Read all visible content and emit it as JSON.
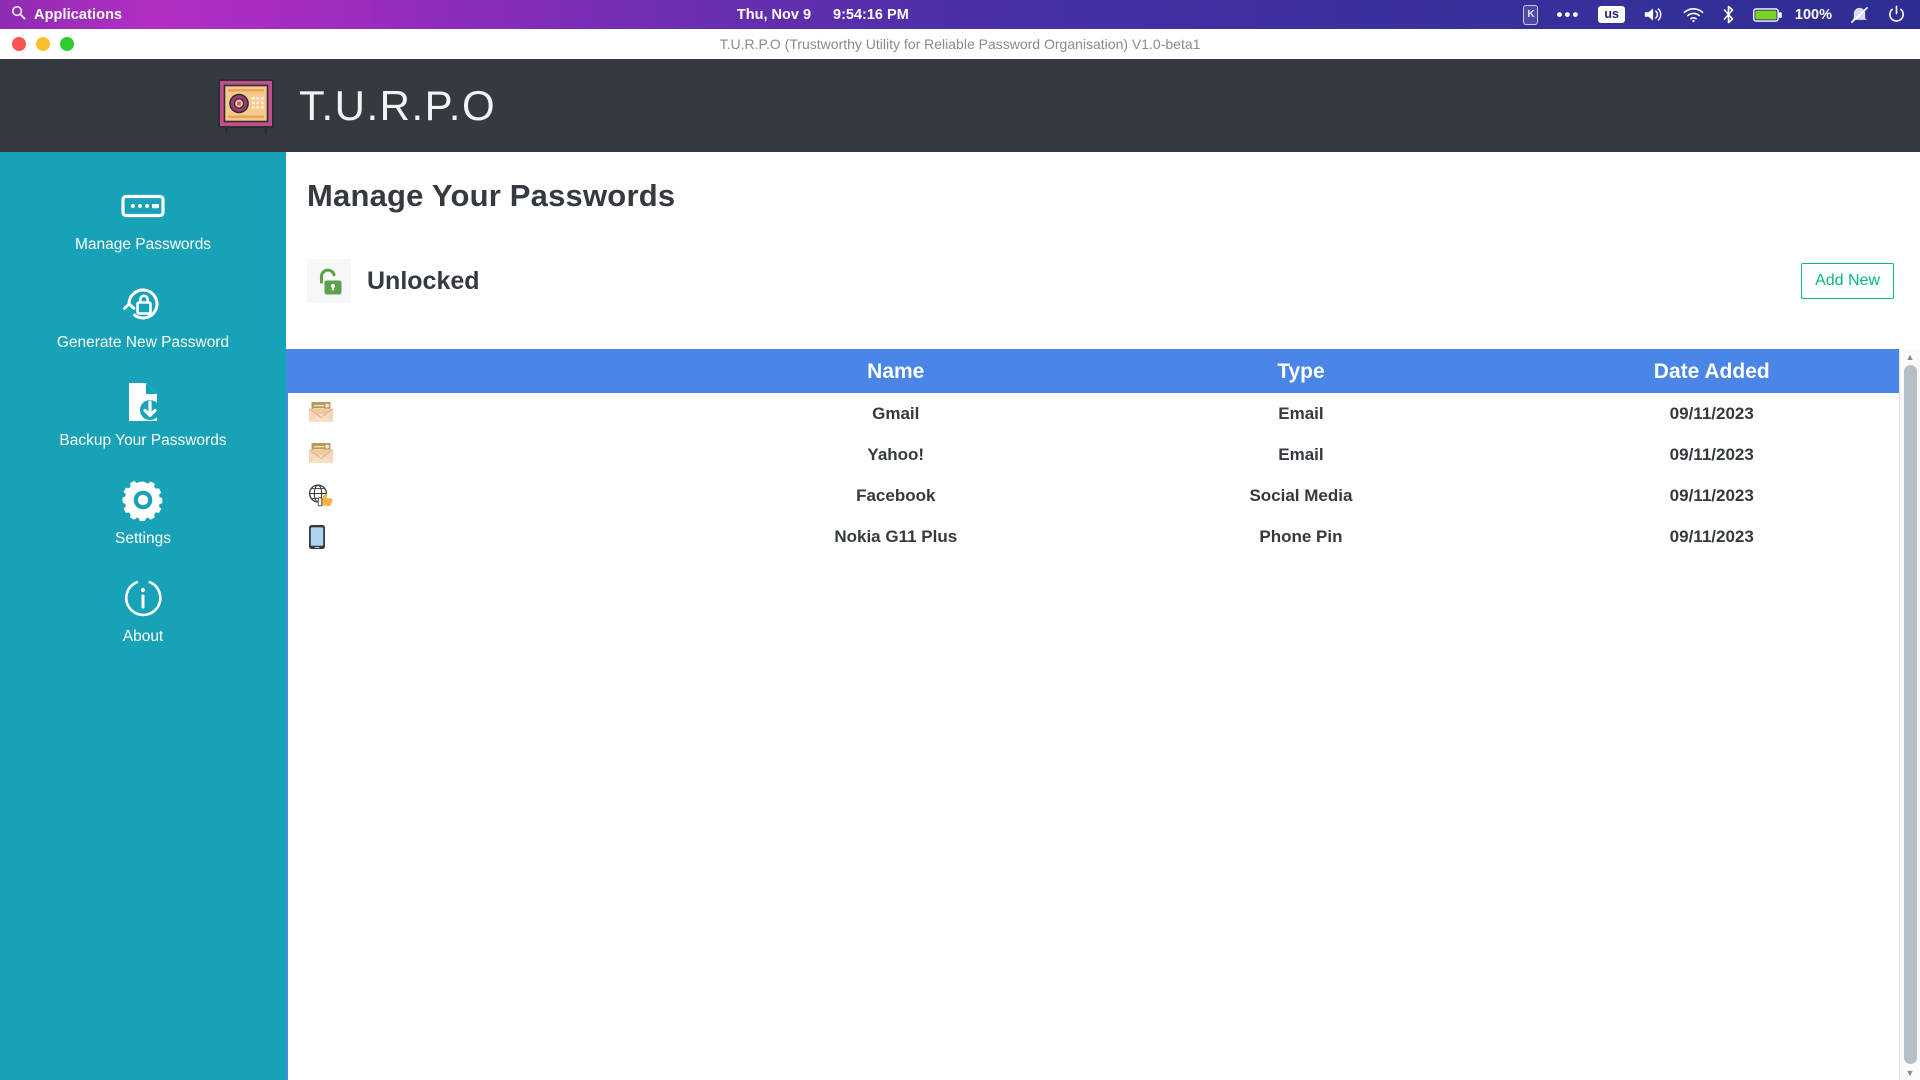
{
  "os_bar": {
    "applications_label": "Applications",
    "search_icon": "search-icon",
    "date": "Thu, Nov  9",
    "time": "9:54:16 PM",
    "tray": {
      "keyboard_icon": "K",
      "overflow_icon": "•••",
      "keyboard_layout": "us",
      "volume_icon": "volume-icon",
      "wifi_icon": "wifi-icon",
      "bluetooth_icon": "bluetooth-icon",
      "battery_percent": "100%",
      "notifications_icon": "bell-muted-icon",
      "power_icon": "power-icon"
    }
  },
  "window": {
    "title": "T.U.R.P.O (Trustworthy Utility for Reliable Password Organisation) V1.0-beta1",
    "controls": {
      "close": "close-button",
      "minimize": "minimize-button",
      "maximize": "maximize-button"
    }
  },
  "app_header": {
    "logo_icon": "safe-vault-icon",
    "brand": "T.U.R.P.O"
  },
  "sidebar": {
    "items": [
      {
        "label": "Manage Passwords",
        "icon": "password-field-icon"
      },
      {
        "label": "Generate New Password",
        "icon": "lock-refresh-icon"
      },
      {
        "label": "Backup Your Passwords",
        "icon": "file-download-icon"
      },
      {
        "label": "Settings",
        "icon": "gear-icon"
      },
      {
        "label": "About",
        "icon": "info-circle-icon"
      }
    ]
  },
  "main": {
    "page_title": "Manage Your Passwords",
    "status": {
      "label": "Unlocked",
      "icon": "unlocked-padlock-icon",
      "color": "#5fa04e"
    },
    "add_new_label": "Add New",
    "accent_colors": {
      "sidebar": "#17a2b8",
      "header": "#343a40",
      "table_header": "#4a86e8",
      "add_new_border": "#04b97f"
    },
    "table": {
      "columns": [
        "",
        "Name",
        "Type",
        "Date Added"
      ],
      "rows": [
        {
          "icon": "envelope-icon",
          "name": "Gmail",
          "type": "Email",
          "date": "09/11/2023"
        },
        {
          "icon": "envelope-icon",
          "name": "Yahoo!",
          "type": "Email",
          "date": "09/11/2023"
        },
        {
          "icon": "globe-thumbsup-icon",
          "name": "Facebook",
          "type": "Social Media",
          "date": "09/11/2023"
        },
        {
          "icon": "smartphone-icon",
          "name": "Nokia G11 Plus",
          "type": "Phone Pin",
          "date": "09/11/2023"
        }
      ]
    },
    "scrollbar": {
      "up": "▲",
      "down": "▼"
    }
  }
}
